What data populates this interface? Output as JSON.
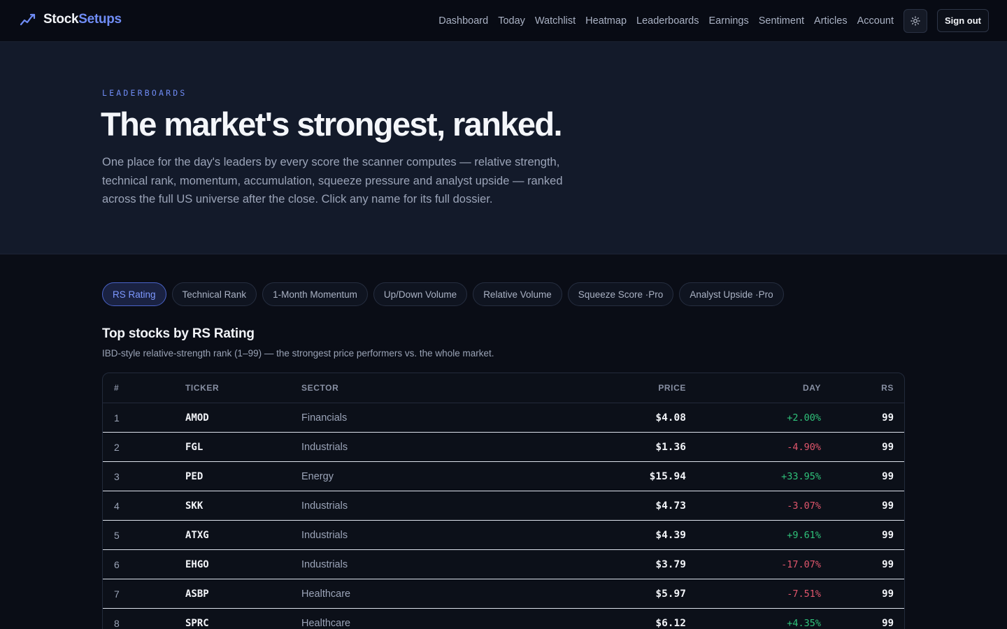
{
  "brand": {
    "part1": "Stock",
    "part2": "Setups",
    "accent": "#6f8cf5"
  },
  "nav": {
    "items": [
      "Dashboard",
      "Today",
      "Watchlist",
      "Heatmap",
      "Leaderboards",
      "Earnings",
      "Sentiment",
      "Articles",
      "Account"
    ],
    "theme_icon": "sun-icon",
    "signout_label": "Sign out"
  },
  "hero": {
    "eyebrow": "LEADERBOARDS",
    "title": "The market's strongest, ranked.",
    "description": "One place for the day's leaders by every score the scanner computes — relative strength, technical rank, momentum, accumulation, squeeze pressure and analyst upside — ranked across the full US universe after the close. Click any name for its full dossier."
  },
  "tabs": [
    {
      "label": "RS Rating",
      "active": true
    },
    {
      "label": "Technical Rank",
      "active": false
    },
    {
      "label": "1-Month Momentum",
      "active": false
    },
    {
      "label": "Up/Down Volume",
      "active": false
    },
    {
      "label": "Relative Volume",
      "active": false
    },
    {
      "label": "Squeeze Score ·Pro",
      "active": false
    },
    {
      "label": "Analyst Upside ·Pro",
      "active": false
    }
  ],
  "section": {
    "title": "Top stocks by RS Rating",
    "subtitle": "IBD-style relative-strength rank (1–99) — the strongest price performers vs. the whole market."
  },
  "table": {
    "headers": {
      "rank": "#",
      "ticker": "TICKER",
      "sector": "SECTOR",
      "price": "PRICE",
      "day": "DAY",
      "rs": "RS"
    },
    "rows": [
      {
        "rank": "1",
        "ticker": "AMOD",
        "sector": "Financials",
        "price": "$4.08",
        "day": "+2.00%",
        "rs": "99"
      },
      {
        "rank": "2",
        "ticker": "FGL",
        "sector": "Industrials",
        "price": "$1.36",
        "day": "-4.90%",
        "rs": "99"
      },
      {
        "rank": "3",
        "ticker": "PED",
        "sector": "Energy",
        "price": "$15.94",
        "day": "+33.95%",
        "rs": "99"
      },
      {
        "rank": "4",
        "ticker": "SKK",
        "sector": "Industrials",
        "price": "$4.73",
        "day": "-3.07%",
        "rs": "99"
      },
      {
        "rank": "5",
        "ticker": "ATXG",
        "sector": "Industrials",
        "price": "$4.39",
        "day": "+9.61%",
        "rs": "99"
      },
      {
        "rank": "6",
        "ticker": "EHGO",
        "sector": "Industrials",
        "price": "$3.79",
        "day": "-17.07%",
        "rs": "99"
      },
      {
        "rank": "7",
        "ticker": "ASBP",
        "sector": "Healthcare",
        "price": "$5.97",
        "day": "-7.51%",
        "rs": "99"
      },
      {
        "rank": "8",
        "ticker": "SPRC",
        "sector": "Healthcare",
        "price": "$6.12",
        "day": "+4.35%",
        "rs": "99"
      }
    ]
  },
  "colors": {
    "up": "#2fc27a",
    "down": "#e0566c",
    "background": "#0a0d16",
    "hero": "#131a2a"
  }
}
